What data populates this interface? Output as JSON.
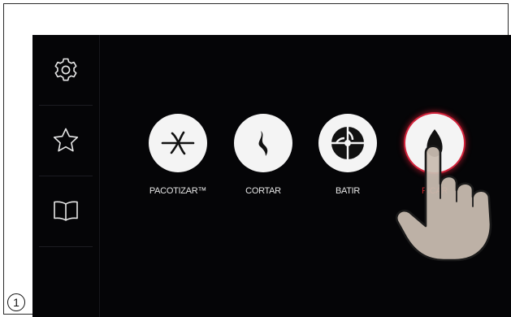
{
  "sidebar": {
    "items": [
      {
        "name": "settings",
        "icon": "gear-icon"
      },
      {
        "name": "favorites",
        "icon": "star-icon"
      },
      {
        "name": "recipes",
        "icon": "book-icon"
      }
    ]
  },
  "modes": [
    {
      "label": "PACOTIZAR™",
      "icon": "pacotizar-blade-icon",
      "active": false
    },
    {
      "label": "CORTAR",
      "icon": "cut-blade-icon",
      "active": false
    },
    {
      "label": "BATIR",
      "icon": "whisk-icon",
      "active": false
    },
    {
      "label": "PICAR",
      "icon": "chop-blade-icon",
      "active": true
    }
  ],
  "step": {
    "number": "1"
  },
  "colors": {
    "screen": "#050507",
    "accent": "#d1223a",
    "button": "#f4f4f4",
    "label": "#e6e6e6"
  },
  "overlay": {
    "icon": "pointing-hand-icon"
  }
}
